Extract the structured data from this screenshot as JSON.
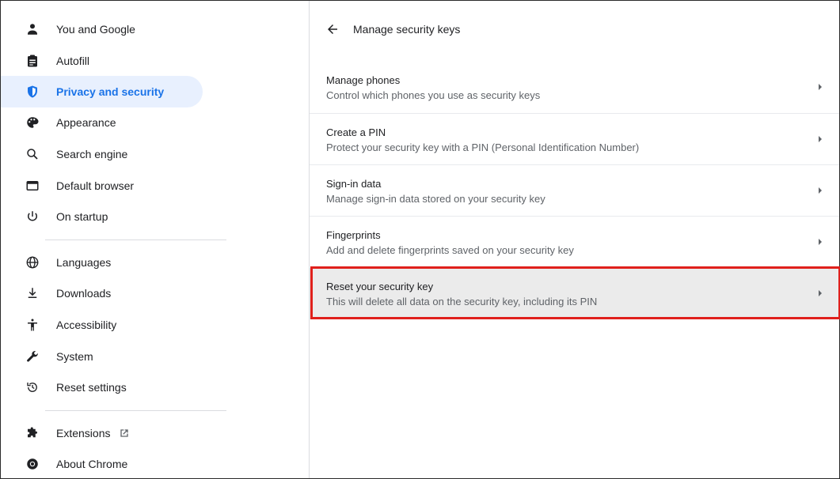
{
  "sidebar": {
    "items": [
      {
        "label": "You and Google",
        "icon": "person-icon"
      },
      {
        "label": "Autofill",
        "icon": "clipboard-icon"
      },
      {
        "label": "Privacy and security",
        "icon": "shield-icon"
      },
      {
        "label": "Appearance",
        "icon": "palette-icon"
      },
      {
        "label": "Search engine",
        "icon": "search-icon"
      },
      {
        "label": "Default browser",
        "icon": "browser-window-icon"
      },
      {
        "label": "On startup",
        "icon": "power-icon"
      },
      {
        "label": "Languages",
        "icon": "globe-icon"
      },
      {
        "label": "Downloads",
        "icon": "download-icon"
      },
      {
        "label": "Accessibility",
        "icon": "accessibility-icon"
      },
      {
        "label": "System",
        "icon": "wrench-icon"
      },
      {
        "label": "Reset settings",
        "icon": "reset-history-icon"
      },
      {
        "label": "Extensions",
        "icon": "puzzle-icon"
      },
      {
        "label": "About Chrome",
        "icon": "chrome-icon"
      }
    ],
    "active_label": "Privacy and security"
  },
  "header": {
    "title": "Manage security keys"
  },
  "rows": [
    {
      "title": "Manage phones",
      "subtitle": "Control which phones you use as security keys"
    },
    {
      "title": "Create a PIN",
      "subtitle": "Protect your security key with a PIN (Personal Identification Number)"
    },
    {
      "title": "Sign-in data",
      "subtitle": "Manage sign-in data stored on your security key"
    },
    {
      "title": "Fingerprints",
      "subtitle": "Add and delete fingerprints saved on your security key"
    },
    {
      "title": "Reset your security key",
      "subtitle": "This will delete all data on the security key, including its PIN"
    }
  ],
  "colors": {
    "accent": "#1a73e8",
    "active_bg": "#e8f0fe",
    "highlight_border": "#e0201c",
    "hover_row": "#ebebeb"
  }
}
